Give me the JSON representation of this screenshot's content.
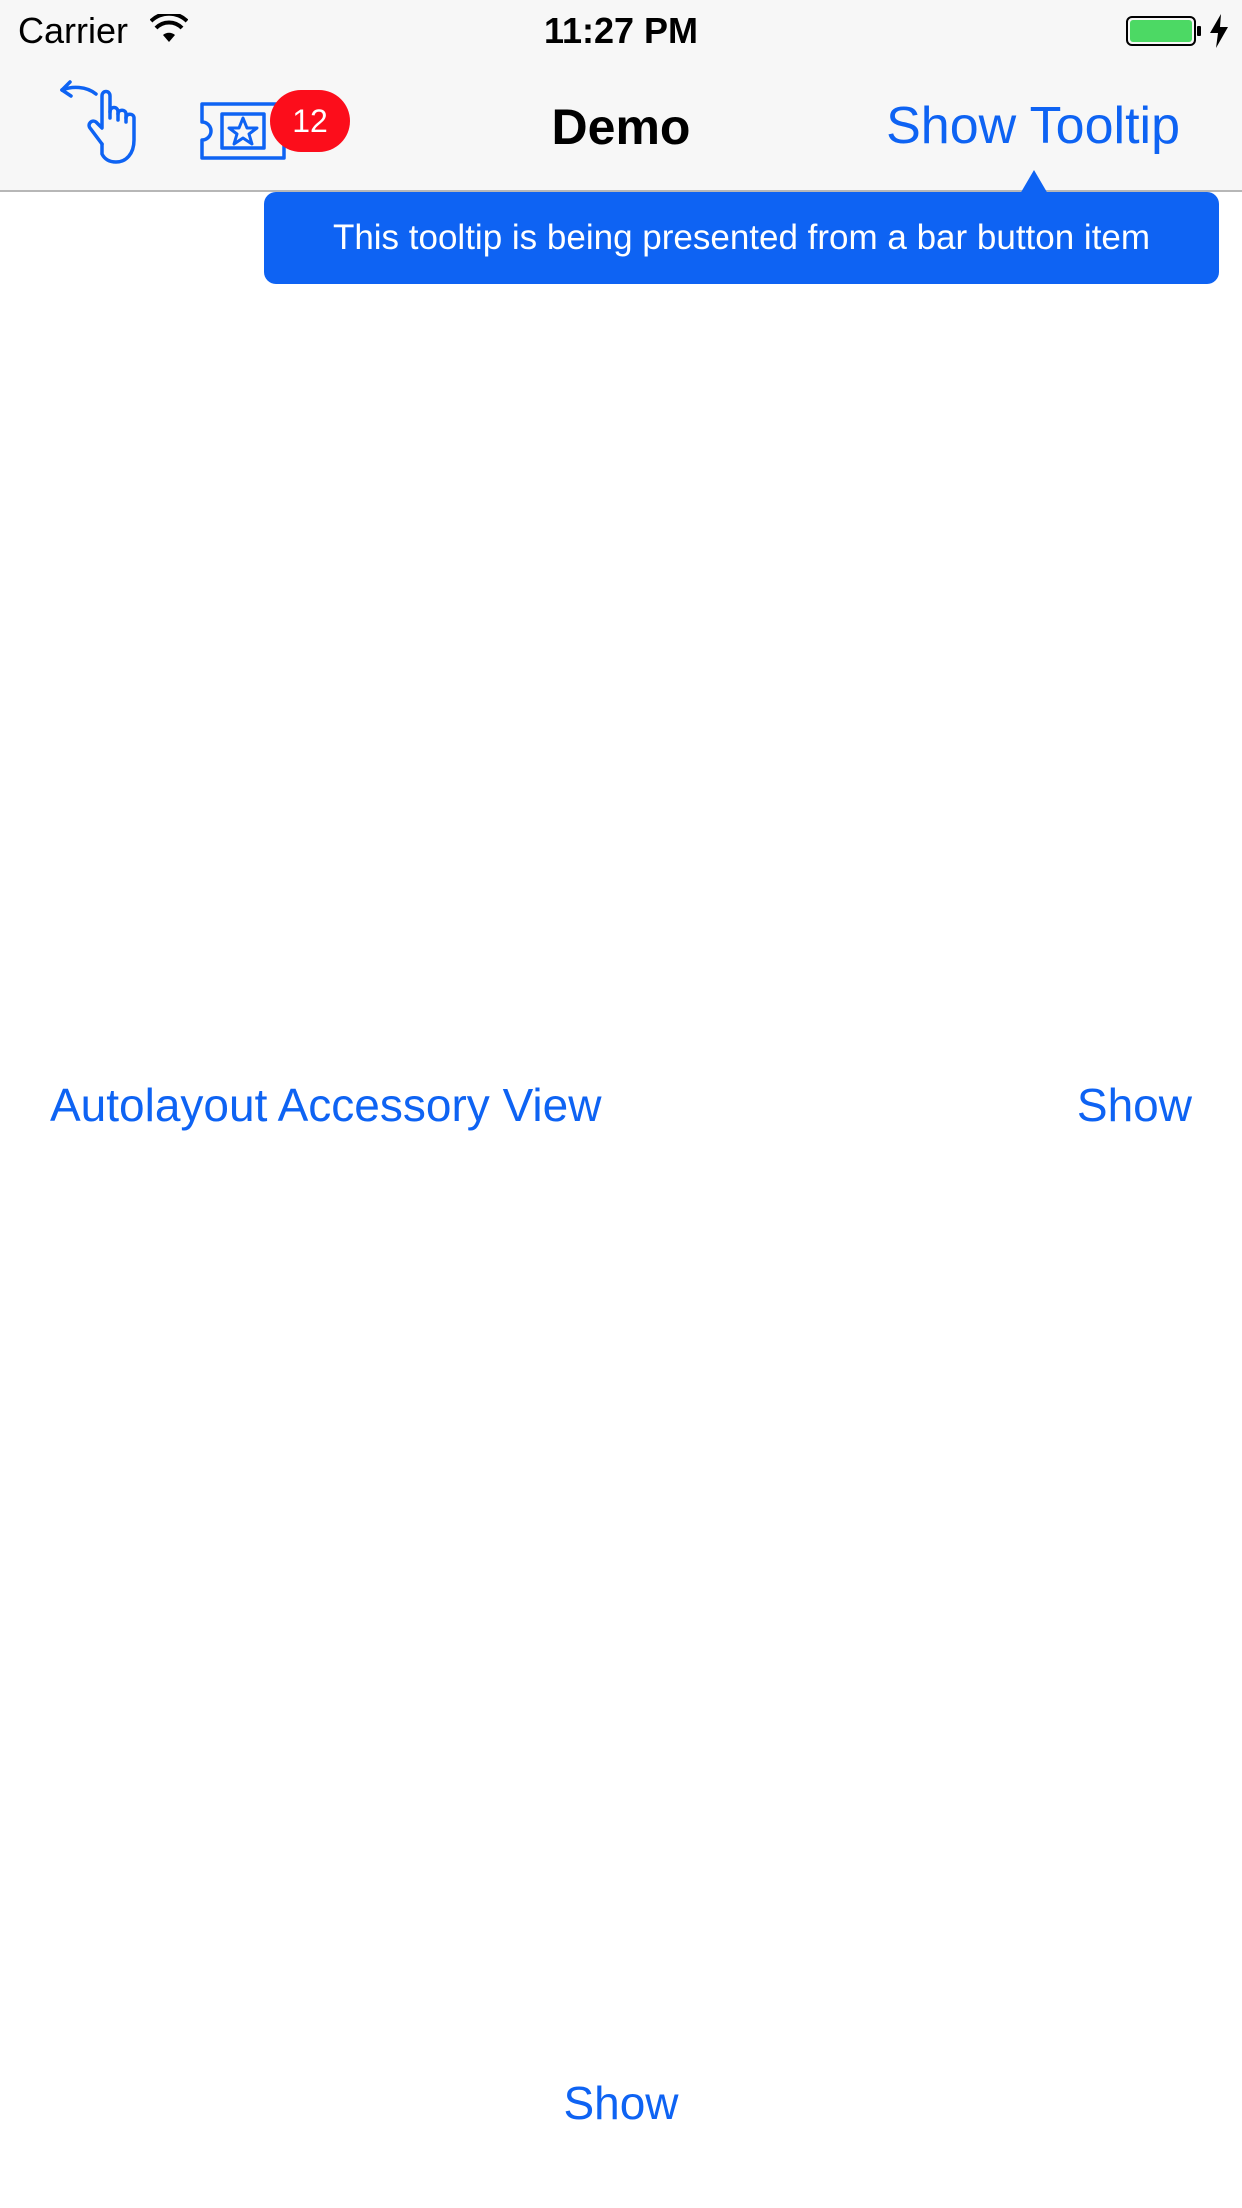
{
  "status_bar": {
    "carrier": "Carrier",
    "time": "11:27 PM",
    "icons": [
      "wifi-icon",
      "battery-icon",
      "charging-icon"
    ],
    "battery_color": "#4cd964"
  },
  "nav_bar": {
    "title": "Demo",
    "left_icons": [
      "gesture-icon",
      "ticket-icon"
    ],
    "badge_count": "12",
    "badge_color": "#fc0d1b",
    "right_button_label": "Show Tooltip"
  },
  "tooltip": {
    "text": "This tooltip is being presented from a bar button item",
    "color": "#0e63f3"
  },
  "main": {
    "accessory_row_label": "Autolayout Accessory View",
    "accessory_row_button": "Show",
    "bottom_button": "Show"
  },
  "theme": {
    "accent": "#0e63f3",
    "bar_background": "#f7f7f7"
  }
}
